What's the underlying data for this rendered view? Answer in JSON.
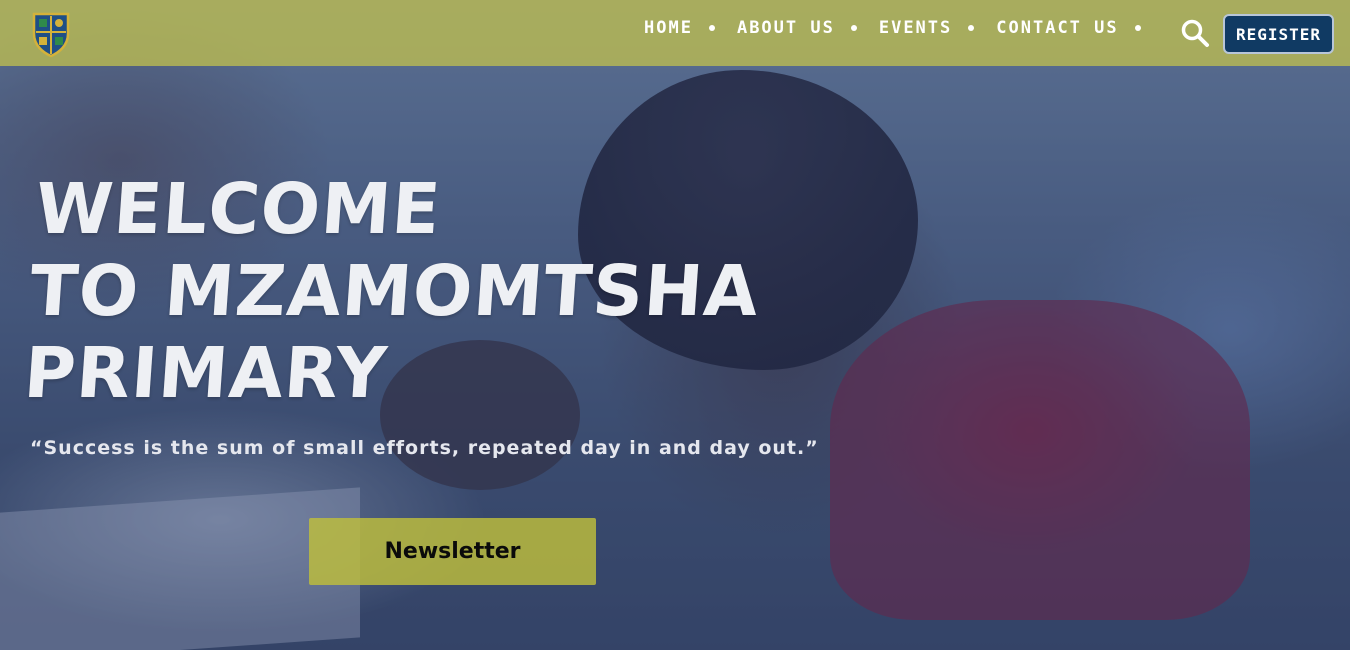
{
  "header": {
    "logo_icon": "school-crest-icon",
    "nav": [
      {
        "label": "Home"
      },
      {
        "label": "About Us"
      },
      {
        "label": "Events"
      },
      {
        "label": "Contact Us"
      }
    ],
    "search_icon": "search-icon",
    "register_label": "Register"
  },
  "hero": {
    "title_lines": [
      "Welcome",
      "to Mzamomtsha",
      "Primary"
    ],
    "quote": "“Success is the sum of small efforts, repeated day in and day out.”",
    "newsletter_label": "Newsletter"
  },
  "colors": {
    "header_bg": "#bebe50",
    "register_bg": "#103a63",
    "newsletter_bg": "#bebe3c",
    "title_text": "#eef0f4"
  }
}
